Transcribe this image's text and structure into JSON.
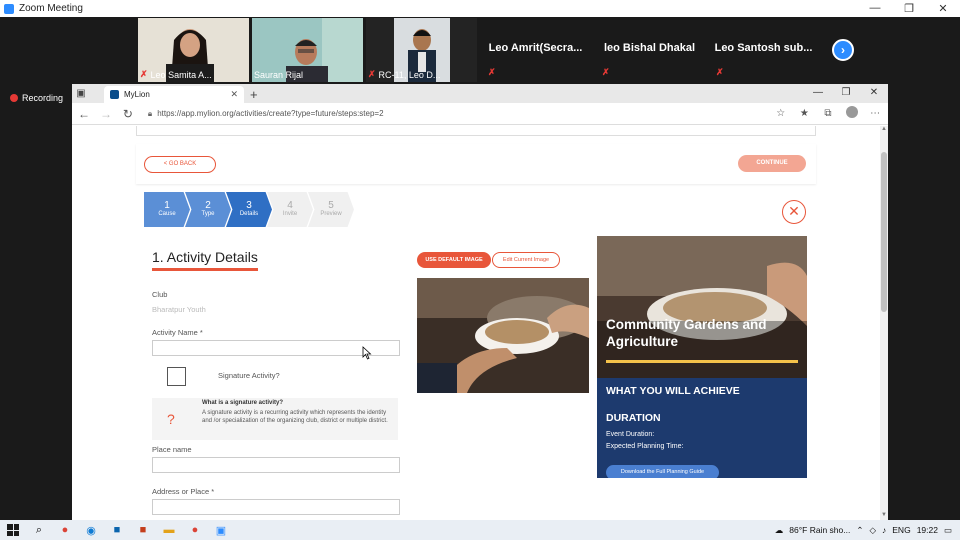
{
  "zoom": {
    "title": "Zoom Meeting",
    "recording": "Recording",
    "participants": [
      {
        "name": "Leo Samita A..."
      },
      {
        "name": "Sauran Rijal"
      },
      {
        "name": "RC-11, Leo D..."
      },
      {
        "name": "Leo  Amrit(Secra..."
      },
      {
        "name": "leo Bishal Dhakal"
      },
      {
        "name": "Leo Santosh sub..."
      }
    ],
    "window_controls": [
      "—",
      "❐",
      "✕"
    ]
  },
  "browser": {
    "tab_title": "MyLion",
    "url": "https://app.mylion.org/activities/create?type=future/steps:step=2",
    "window_controls": [
      "—",
      "❐",
      "✕"
    ]
  },
  "page": {
    "go_back": "< GO BACK",
    "continue": "CONTINUE",
    "steps": [
      {
        "num": "1",
        "label": "Cause",
        "state": "done"
      },
      {
        "num": "2",
        "label": "Type",
        "state": "done"
      },
      {
        "num": "3",
        "label": "Details",
        "state": "active"
      },
      {
        "num": "4",
        "label": "Invite",
        "state": "todo"
      },
      {
        "num": "5",
        "label": "Preview",
        "state": "todo"
      }
    ],
    "form_title": "1. Activity Details",
    "club_label": "Club",
    "club_value": "Bharatpur Youth",
    "activity_name_label": "Activity Name *",
    "signature_label": "Signature Activity?",
    "info_heading": "What is a signature activity?",
    "info_text": "A signature activity is a recurring activity which represents the identity and /or specialization of the organizing club, district or multiple district.",
    "place_name_label": "Place name",
    "address_label": "Address or Place *",
    "use_default_image": "USE DEFAULT IMAGE",
    "edit_current_image": "Edit Current Image"
  },
  "panel": {
    "title": "Community Gardens and Agriculture",
    "achieve": "WHAT YOU WILL ACHIEVE",
    "duration": "DURATION",
    "event_duration": "Event Duration:",
    "planning_time": "Expected Planning Time:",
    "download": "Download the Full Planning Guide"
  },
  "taskbar": {
    "weather": "86°F  Rain sho...",
    "lang": "ENG",
    "time": "19:22"
  },
  "colors": {
    "accent": "#e8563a",
    "panel_bg": "#1d3a6e",
    "step_active": "#2f6fc4",
    "zoom_blue": "#2d8cff"
  }
}
